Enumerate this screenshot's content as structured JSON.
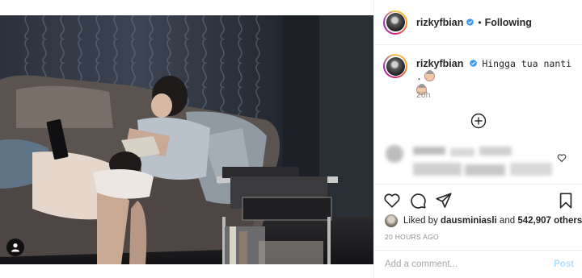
{
  "post": {
    "username": "rizkyfbian",
    "follow_status": "Following",
    "separator": "•",
    "caption_text": "Hingga tua nanti .",
    "caption_time": "20h",
    "likes_prefix": "Liked by",
    "liked_by_user": "dausminiasli",
    "likes_and": "and",
    "likes_count_text": "542,907 others",
    "post_time": "20 HOURS AGO",
    "comment_placeholder": "Add a comment...",
    "post_button": "Post"
  },
  "icons": {
    "verified": "verified-badge-icon",
    "like": "heart-icon",
    "comment": "comment-bubble-icon",
    "share": "paper-plane-icon",
    "save": "bookmark-icon",
    "load_more": "plus-circle-icon",
    "user_tags": "user-silhouette-icon"
  },
  "colors": {
    "verified_blue": "#3897f0",
    "post_button_disabled": "#b2dffc",
    "secondary_text": "#8e8e8e"
  }
}
